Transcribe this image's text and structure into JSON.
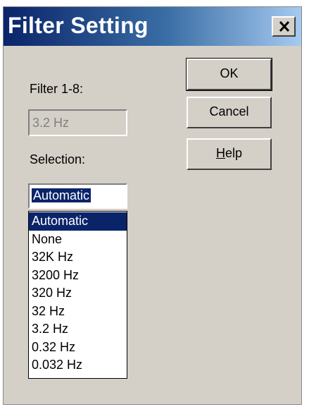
{
  "window": {
    "title": "Filter Setting",
    "close_icon": "close-x-icon"
  },
  "filter": {
    "label": "Filter 1-8:",
    "value": "3.2 Hz"
  },
  "selection": {
    "label": "Selection:",
    "current": "Automatic",
    "options": [
      "Automatic",
      "None",
      "32K Hz",
      "3200 Hz",
      "320 Hz",
      "32 Hz",
      "3.2 Hz",
      "0.32 Hz",
      "0.032 Hz"
    ],
    "selected_index": 0
  },
  "buttons": {
    "ok": "OK",
    "cancel": "Cancel",
    "help_accel": "H",
    "help_rest": "elp"
  },
  "colors": {
    "face": "#d4d0c8",
    "title_active": "#0a246a",
    "highlight": "#0a246a"
  }
}
